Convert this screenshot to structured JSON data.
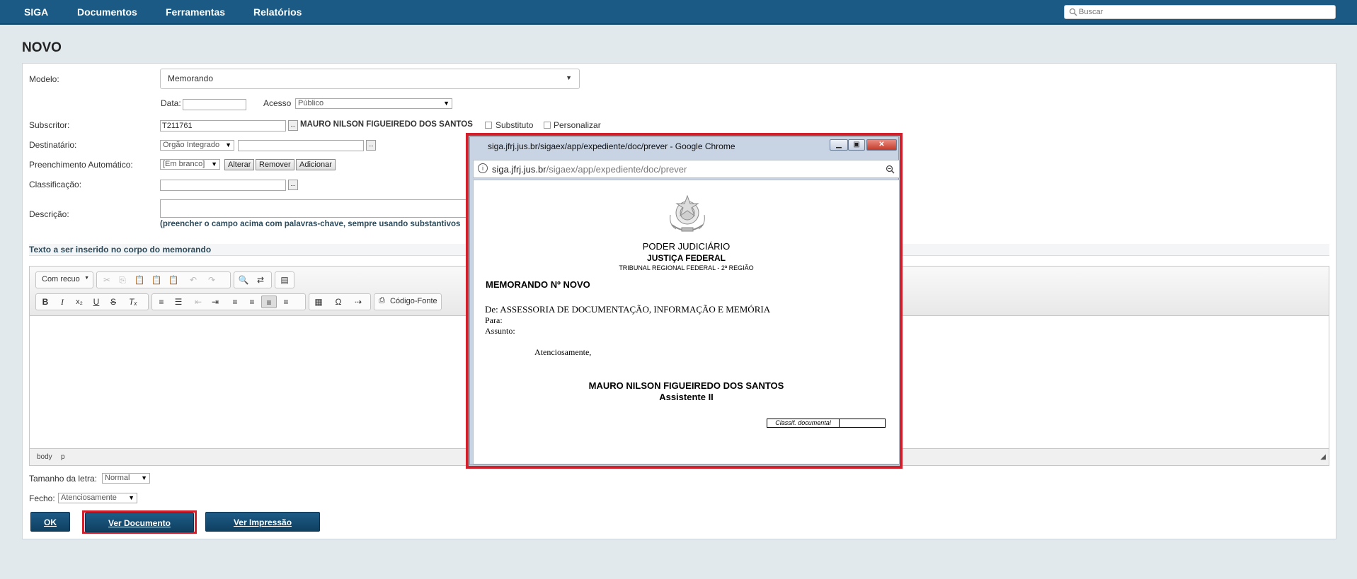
{
  "navbar": {
    "items": [
      "SIGA",
      "Documentos",
      "Ferramentas",
      "Relatórios"
    ],
    "search_placeholder": "Buscar"
  },
  "page_title": "NOVO",
  "form": {
    "modelo": {
      "label": "Modelo:",
      "value": "Memorando"
    },
    "data": {
      "label": "Data:",
      "value": ""
    },
    "acesso": {
      "label": "Acesso",
      "value": "Público"
    },
    "subscritor": {
      "label": "Subscritor:",
      "value": "T211761",
      "name": "MAURO NILSON FIGUEIREDO DOS SANTOS",
      "substituto": "Substituto",
      "personalizar": "Personalizar"
    },
    "destinatario": {
      "label": "Destinatário:",
      "type": "Orgão Integrado",
      "value": ""
    },
    "preenchimento": {
      "label": "Preenchimento Automático:",
      "value": "[Em branco]",
      "alterar": "Alterar",
      "remover": "Remover",
      "adicionar": "Adicionar"
    },
    "classificacao": {
      "label": "Classificação:",
      "value": ""
    },
    "descricao": {
      "label": "Descrição:",
      "value": "",
      "hint": "(preencher o campo acima com palavras-chave, sempre usando substantivos"
    },
    "texto_label": "Texto a ser inserido no corpo do memorando",
    "dots": "..."
  },
  "editor": {
    "format_label": "Com recuo",
    "source_label": "Código-Fonte",
    "statusbar": [
      "body",
      "p"
    ]
  },
  "footer": {
    "tamanho_label": "Tamanho da letra:",
    "tamanho_value": "Normal",
    "fecho_label": "Fecho:",
    "fecho_value": "Atenciosamente",
    "ok": "OK",
    "ver_documento": "Ver Documento",
    "ver_impressao": "Ver Impressão"
  },
  "popup": {
    "title": "siga.jfrj.jus.br/sigaex/app/expediente/doc/prever - Google Chrome",
    "url_host": "siga.jfrj.jus.br",
    "url_path": "/sigaex/app/expediente/doc/prever",
    "doc": {
      "poder": "PODER JUDICIÁRIO",
      "justica": "JUSTIÇA FEDERAL",
      "tribunal": "TRIBUNAL REGIONAL FEDERAL - 2ª REGIÃO",
      "memorando": "MEMORANDO Nº NOVO",
      "de": "De: ASSESSORIA DE DOCUMENTAÇÃO, INFORMAÇÃO E MEMÓRIA",
      "para": "Para:",
      "assunto": "Assunto:",
      "fecho": "Atenciosamente,",
      "signer": "MAURO NILSON FIGUEIREDO DOS SANTOS",
      "role": "Assistente II",
      "classif": "Classif. documental"
    }
  },
  "colors": {
    "navbar": "#1a5a84",
    "button": "#1d5c87",
    "highlight": "#d11f2b"
  }
}
